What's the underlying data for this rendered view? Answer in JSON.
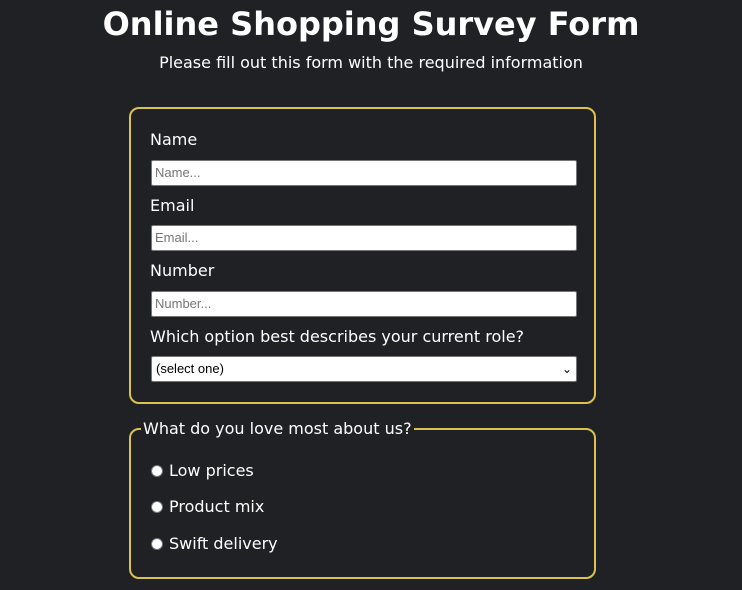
{
  "header": {
    "title": "Online Shopping Survey Form",
    "subtitle": "Please fill out this form with the required information"
  },
  "form": {
    "name": {
      "label": "Name",
      "placeholder": "Name..."
    },
    "email": {
      "label": "Email",
      "placeholder": "Email..."
    },
    "number": {
      "label": "Number",
      "placeholder": "Number..."
    },
    "role": {
      "label": "Which option best describes your current role?",
      "selected": "(select one)"
    }
  },
  "love": {
    "legend": "What do you love most about us?",
    "options": [
      "Low prices",
      "Product mix",
      "Swift delivery"
    ]
  },
  "colors": {
    "background": "#202124",
    "accent": "#d9c24f",
    "text": "#ffffff"
  }
}
